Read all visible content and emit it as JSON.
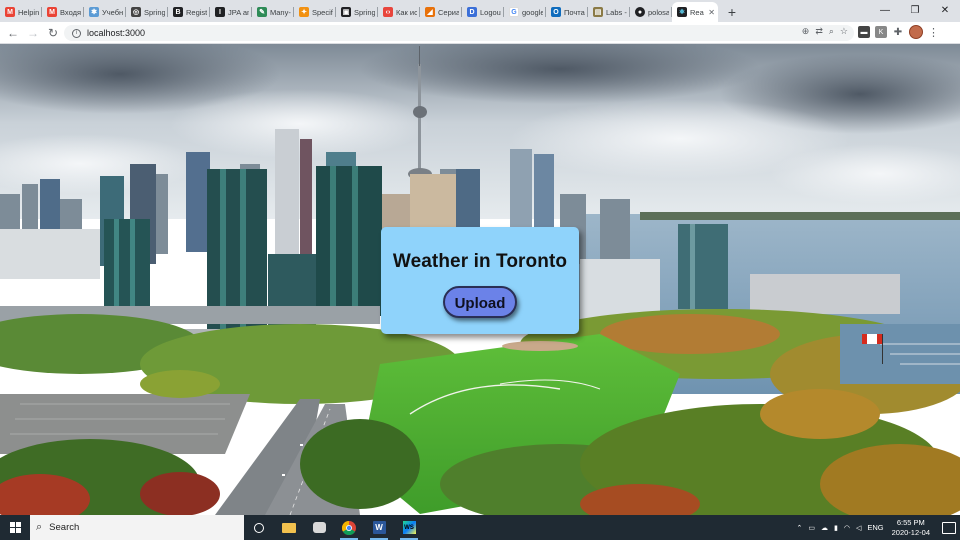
{
  "browser": {
    "tabs": [
      {
        "label": "Helpin",
        "icon": "gmail-icon",
        "color": "#ea4335"
      },
      {
        "label": "Входящ",
        "icon": "gmail-icon",
        "color": "#ea4335"
      },
      {
        "label": "Учебн",
        "icon": "lms-icon",
        "color": "#5b9bd5"
      },
      {
        "label": "Spring",
        "icon": "spring-icon",
        "color": "#444444"
      },
      {
        "label": "Registr",
        "icon": "registry-icon",
        "color": "#202124"
      },
      {
        "label": "JPA and",
        "icon": "jpa-icon",
        "color": "#202124"
      },
      {
        "label": "Many-",
        "icon": "many-icon",
        "color": "#2e8b57"
      },
      {
        "label": "Specify",
        "icon": "specify-icon",
        "color": "#f29111"
      },
      {
        "label": "Spring",
        "icon": "spring-video-icon",
        "color": "#202124"
      },
      {
        "label": "Как ис",
        "icon": "code-icon",
        "color": "#e8453c"
      },
      {
        "label": "Сериа",
        "icon": "serial-icon",
        "color": "#e8710a"
      },
      {
        "label": "Logout",
        "icon": "logout-icon",
        "color": "#3b6fd8"
      },
      {
        "label": "google",
        "icon": "google-icon",
        "color": "#4285f4"
      },
      {
        "label": "Почта",
        "icon": "outlook-icon",
        "color": "#0f6cbd"
      },
      {
        "label": "Labs -",
        "icon": "labs-icon",
        "color": "#8a7a45"
      },
      {
        "label": "polosa",
        "icon": "github-icon",
        "color": "#202124"
      },
      {
        "label": "Rea",
        "icon": "react-icon",
        "color": "#202124",
        "active": true
      }
    ],
    "new_tab_label": "+",
    "url": "localhost:3000"
  },
  "page": {
    "title": "Weather in Toronto",
    "upload_label": "Upload"
  },
  "taskbar": {
    "search_placeholder": "Search",
    "language": "ENG",
    "time": "6:55 PM",
    "date": "2020-12-04"
  }
}
